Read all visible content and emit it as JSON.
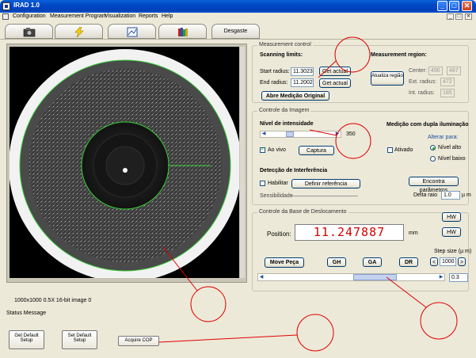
{
  "window": {
    "title": "IRAD 1.0",
    "controls": [
      "_",
      "□",
      "✕"
    ]
  },
  "menu": {
    "items": [
      "Configuration",
      "Measurement Program",
      "Visualization",
      "Reports",
      "Help"
    ],
    "mdi_controls": [
      "_",
      "□",
      "✕"
    ]
  },
  "toolbar": {
    "tabs": [
      {
        "icon": "camera-icon"
      },
      {
        "icon": "lightning-icon"
      },
      {
        "icon": "chart-icon"
      },
      {
        "icon": "books-icon"
      },
      {
        "label": "Desgaste"
      }
    ]
  },
  "image_info": "1000x1000  0.5X  16-bit image  0",
  "measurement_control": {
    "title": "Measurement control",
    "scanning_limits": "Scanning limits:",
    "start_radius_label": "Start radius:",
    "start_radius": "11.3023",
    "end_radius_label": "End radius:",
    "end_radius": "11.2002",
    "get_actual": "Get actual",
    "abre_medicao": "Abre Medição Original",
    "measurement_region": "Measurement region:",
    "atualiza": "Atualiza região",
    "center_label": "Center:",
    "center_x": "490",
    "center_y": "487",
    "ext_radius_label": "Ext. radius:",
    "ext_radius": "472",
    "int_radius_label": "Int. radius:",
    "int_radius": "185"
  },
  "controle_imagem": {
    "title": "Controle da Imagem",
    "nivel_label": "Nível de intensidade",
    "nivel_value": "350",
    "ao_vivo": "Ao vivo",
    "captura": "Captura",
    "dupla": "Medição com dupla iluminação",
    "alterar": "Alterar para:",
    "ativado": "Ativado",
    "nivel_alto": "Nível alto",
    "nivel_baixo": "Nível baixo",
    "deteccao": "Detecção de Interferência",
    "habilitar": "Habilitar",
    "definir": "Definir referência",
    "sensibilidade": "Sensibilidade",
    "encontra": "Encontra parâmetros",
    "delta_label": "Delta raio",
    "delta_value": "1.0",
    "delta_unit": "µ m"
  },
  "deslocamento": {
    "title": "Controle da Base de Deslocamento",
    "hw1": "HW",
    "hw2": "HW",
    "position_label": "Position:",
    "position_value": "11.247887",
    "unit": "mm",
    "move_peca": "Move Peça",
    "gh": "GH",
    "ga": "GA",
    "dr": "DR",
    "step_size_label": "Step size (µ m)",
    "step_value": "1000",
    "step_left": "<",
    "step_right": ">",
    "small_value": "0.3"
  },
  "status": "Status Message",
  "bottom_buttons": {
    "get_default": "Get Default Setup",
    "set_default": "Set Default Setup",
    "acquire": "Acquire COP"
  }
}
